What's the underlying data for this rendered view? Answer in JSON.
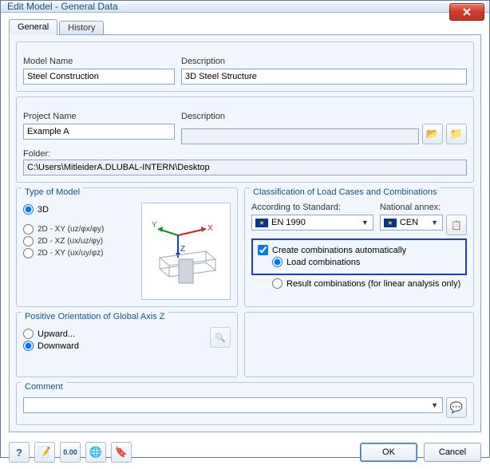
{
  "window": {
    "title": "Edit Model - General Data"
  },
  "tabs": {
    "general": "General",
    "history": "History"
  },
  "modelName": {
    "label": "Model Name",
    "value": "Steel Construction"
  },
  "modelDesc": {
    "label": "Description",
    "value": "3D Steel Structure"
  },
  "projectName": {
    "label": "Project Name",
    "value": "Example A"
  },
  "projectDesc": {
    "label": "Description",
    "value": ""
  },
  "folder": {
    "label": "Folder:",
    "value": "C:\\Users\\MitleiderA.DLUBAL-INTERN\\Desktop"
  },
  "typeOfModel": {
    "title": "Type of Model",
    "opts": {
      "d3": "3D",
      "xy": "2D - XY (uz/φx/φy)",
      "xz": "2D - XZ (ux/uz/φy)",
      "xy2": "2D - XY (ux/uy/φz)"
    }
  },
  "classification": {
    "title": "Classification of Load Cases and Combinations",
    "standardLabel": "According to Standard:",
    "standardValue": "EN 1990",
    "annexLabel": "National annex:",
    "annexValue": "CEN",
    "createCombos": "Create combinations automatically",
    "loadCombos": "Load combinations",
    "resultCombos": "Result combinations (for linear analysis only)"
  },
  "orientation": {
    "title": "Positive Orientation of Global Axis Z",
    "up": "Upward...",
    "down": "Downward"
  },
  "comment": {
    "title": "Comment",
    "value": ""
  },
  "buttons": {
    "ok": "OK",
    "cancel": "Cancel"
  }
}
